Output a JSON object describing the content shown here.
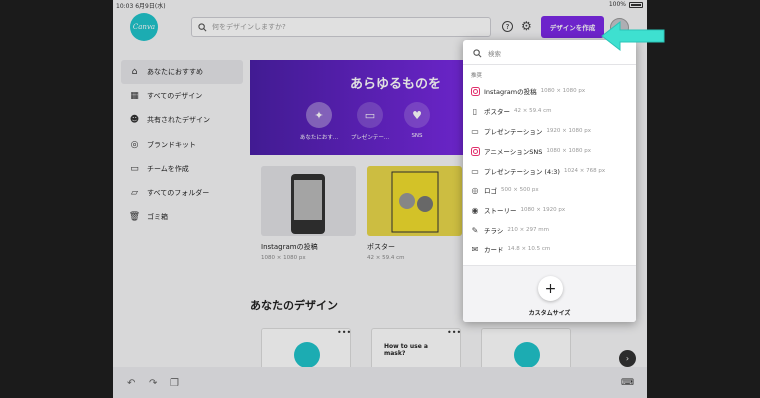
{
  "status": {
    "time": "10:03",
    "date": "6月9日(水)",
    "battery": "100%"
  },
  "logo": {
    "text": "Canva"
  },
  "search": {
    "placeholder": "何をデザインしますか?"
  },
  "header": {
    "create_label": "デザインを作成",
    "help": "?"
  },
  "sidebar": {
    "items": [
      {
        "label": "あなたにおすすめ",
        "icon": "home-icon"
      },
      {
        "label": "すべてのデザイン",
        "icon": "grid-icon"
      },
      {
        "label": "共有されたデザイン",
        "icon": "users-icon"
      },
      {
        "label": "ブランドキット",
        "icon": "brand-icon"
      },
      {
        "label": "チームを作成",
        "icon": "team-icon"
      },
      {
        "label": "すべてのフォルダー",
        "icon": "folder-icon"
      },
      {
        "label": "ゴミ箱",
        "icon": "trash-icon"
      }
    ]
  },
  "hero": {
    "title": "あらゆるものを",
    "categories": [
      {
        "label": "あなたにおす..."
      },
      {
        "label": "プレゼンテー..."
      },
      {
        "label": "SNS"
      }
    ]
  },
  "templates": [
    {
      "label": "Instagramの投稿",
      "size": "1080 × 1080 px"
    },
    {
      "label": "ポスター",
      "size": "42 × 59.4 cm"
    }
  ],
  "designs_section": {
    "title": "あなたのデザイン",
    "card_text": "How to use a mask?"
  },
  "panel": {
    "search_placeholder": "検索",
    "heading": "推奨",
    "items": [
      {
        "label": "Instagramの投稿",
        "size": "1080 × 1080 px",
        "icon": "instagram-icon"
      },
      {
        "label": "ポスター",
        "size": "42 × 59.4 cm",
        "icon": "poster-icon"
      },
      {
        "label": "プレゼンテーション",
        "size": "1920 × 1080 px",
        "icon": "presentation-icon"
      },
      {
        "label": "アニメーションSNS",
        "size": "1080 × 1080 px",
        "icon": "instagram-icon"
      },
      {
        "label": "プレゼンテーション (4:3)",
        "size": "1024 × 768 px",
        "icon": "presentation-icon"
      },
      {
        "label": "ロゴ",
        "size": "500 × 500 px",
        "icon": "logo-icon"
      },
      {
        "label": "ストーリー",
        "size": "1080 × 1920 px",
        "icon": "story-icon"
      },
      {
        "label": "チラシ",
        "size": "210 × 297 mm",
        "icon": "flyer-icon"
      },
      {
        "label": "カード",
        "size": "14.8 × 10.5 cm",
        "icon": "card-icon"
      }
    ],
    "custom_label": "カスタムサイズ",
    "plus": "+"
  },
  "colors": {
    "accent": "#7d2ae8",
    "pointer": "#3ee0d0",
    "logo": "#20c4cb"
  }
}
